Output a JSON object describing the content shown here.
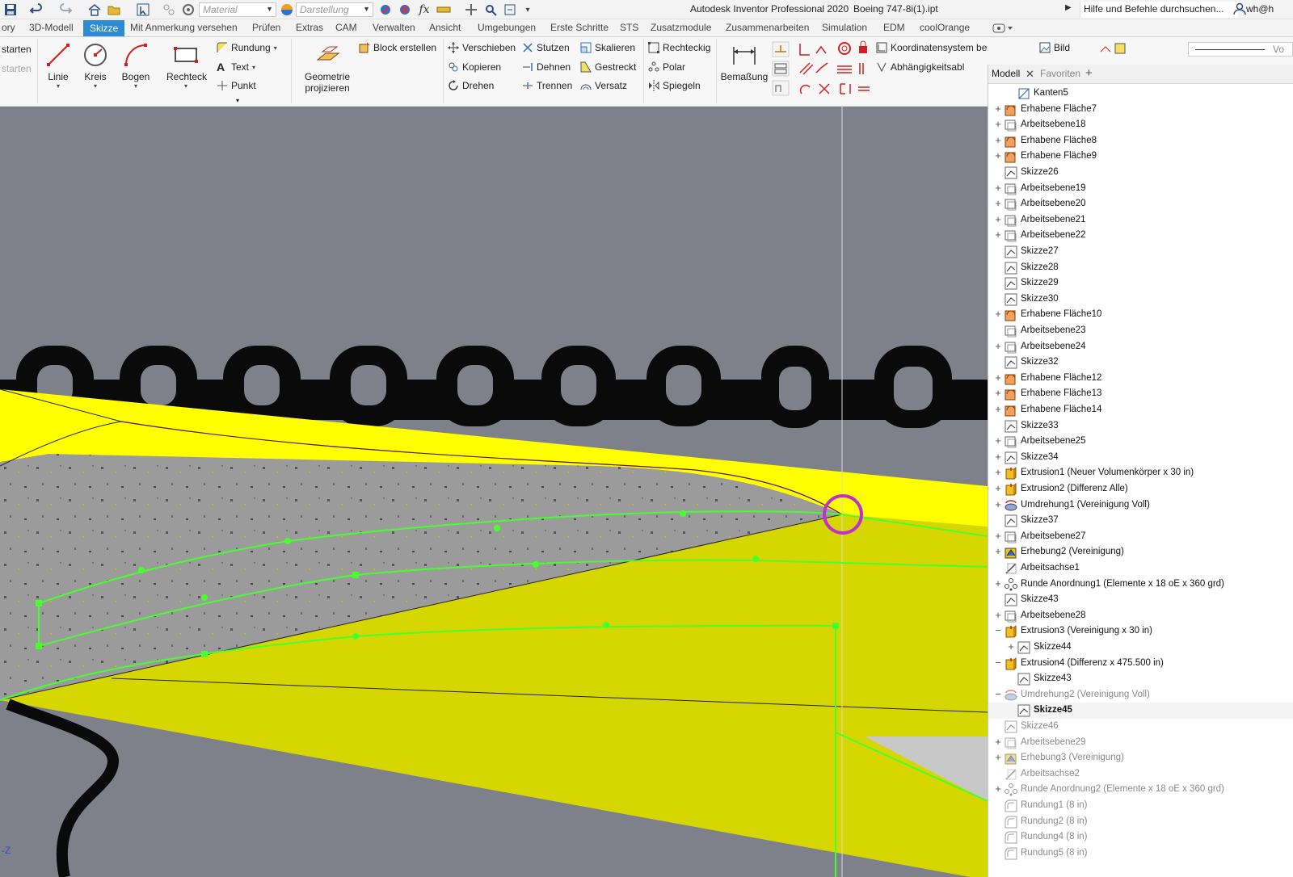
{
  "titlebar": {
    "material_placeholder": "Material",
    "appearance_placeholder": "Darstellung",
    "app_title": "Autodesk Inventor Professional 2020",
    "doc_title": "Boeing 747-8i(1).ipt",
    "help_search": "Hilfe und Befehle durchsuchen...",
    "user": "wh@h"
  },
  "tabs": [
    {
      "label": "ory",
      "active": false
    },
    {
      "label": "3D-Modell",
      "active": false
    },
    {
      "label": "Skizze",
      "active": true
    },
    {
      "label": "Mit Anmerkung versehen",
      "active": false
    },
    {
      "label": "Prüfen",
      "active": false
    },
    {
      "label": "Extras",
      "active": false
    },
    {
      "label": "CAM",
      "active": false
    },
    {
      "label": "Verwalten",
      "active": false
    },
    {
      "label": "Ansicht",
      "active": false
    },
    {
      "label": "Umgebungen",
      "active": false
    },
    {
      "label": "Erste Schritte",
      "active": false
    },
    {
      "label": "STS",
      "active": false
    },
    {
      "label": "Zusatzmodule",
      "active": false
    },
    {
      "label": "Zusammenarbeiten",
      "active": false
    },
    {
      "label": "Simulation",
      "active": false
    },
    {
      "label": "EDM",
      "active": false
    },
    {
      "label": "coolOrange",
      "active": false
    }
  ],
  "ribbon": {
    "start1": "starten",
    "start2": "starten",
    "linie": "Linie",
    "kreis": "Kreis",
    "bogen": "Bogen",
    "rechteck": "Rechteck",
    "rundung": "Rundung",
    "text": "Text",
    "punkt": "Punkt",
    "geometrie1": "Geometrie",
    "geometrie2": "projizieren",
    "block": "Block erstellen",
    "verschieben": "Verschieben",
    "kopieren": "Kopieren",
    "drehen": "Drehen",
    "stutzen": "Stutzen",
    "dehnen": "Dehnen",
    "trennen": "Trennen",
    "skalieren": "Skalieren",
    "gestreckt": "Gestreckt",
    "versatz": "Versatz",
    "rechteckig": "Rechteckig",
    "polar": "Polar",
    "spiegeln": "Spiegeln",
    "bemassung": "Bemaßung",
    "koordinaten": "Koordinatensystem bearbeiten",
    "abhaengigkeit": "Abhängigkeitsabl",
    "bild": "Bild",
    "vor": "Vo"
  },
  "viewport": {
    "axis_label": "-Z"
  },
  "browser": {
    "tab_model": "Modell",
    "tab_favorites": "Favoriten",
    "nodes": [
      {
        "label": "Kanten5",
        "icon": "edges",
        "expander": "",
        "indent": 1,
        "state": "normal"
      },
      {
        "label": "Erhabene Fläche7",
        "icon": "surface",
        "expander": "+",
        "indent": 0,
        "state": "normal"
      },
      {
        "label": "Arbeitsebene18",
        "icon": "plane",
        "expander": "+",
        "indent": 0,
        "state": "normal"
      },
      {
        "label": "Erhabene Fläche8",
        "icon": "surface",
        "expander": "+",
        "indent": 0,
        "state": "normal"
      },
      {
        "label": "Erhabene Fläche9",
        "icon": "surface",
        "expander": "+",
        "indent": 0,
        "state": "normal"
      },
      {
        "label": "Skizze26",
        "icon": "sketch",
        "expander": "",
        "indent": 0,
        "state": "normal"
      },
      {
        "label": "Arbeitsebene19",
        "icon": "plane",
        "expander": "+",
        "indent": 0,
        "state": "normal"
      },
      {
        "label": "Arbeitsebene20",
        "icon": "plane",
        "expander": "+",
        "indent": 0,
        "state": "normal"
      },
      {
        "label": "Arbeitsebene21",
        "icon": "plane",
        "expander": "+",
        "indent": 0,
        "state": "normal"
      },
      {
        "label": "Arbeitsebene22",
        "icon": "plane",
        "expander": "+",
        "indent": 0,
        "state": "normal"
      },
      {
        "label": "Skizze27",
        "icon": "sketch",
        "expander": "",
        "indent": 0,
        "state": "normal"
      },
      {
        "label": "Skizze28",
        "icon": "sketch",
        "expander": "",
        "indent": 0,
        "state": "normal"
      },
      {
        "label": "Skizze29",
        "icon": "sketch",
        "expander": "",
        "indent": 0,
        "state": "normal"
      },
      {
        "label": "Skizze30",
        "icon": "sketch",
        "expander": "",
        "indent": 0,
        "state": "normal"
      },
      {
        "label": "Erhabene Fläche10",
        "icon": "surface",
        "expander": "+",
        "indent": 0,
        "state": "normal"
      },
      {
        "label": "Arbeitsebene23",
        "icon": "plane",
        "expander": "",
        "indent": 0,
        "state": "normal"
      },
      {
        "label": "Arbeitsebene24",
        "icon": "plane",
        "expander": "+",
        "indent": 0,
        "state": "normal"
      },
      {
        "label": "Skizze32",
        "icon": "sketch",
        "expander": "",
        "indent": 0,
        "state": "normal"
      },
      {
        "label": "Erhabene Fläche12",
        "icon": "surface",
        "expander": "+",
        "indent": 0,
        "state": "normal"
      },
      {
        "label": "Erhabene Fläche13",
        "icon": "surface",
        "expander": "+",
        "indent": 0,
        "state": "normal"
      },
      {
        "label": "Erhabene Fläche14",
        "icon": "surface",
        "expander": "+",
        "indent": 0,
        "state": "normal"
      },
      {
        "label": "Skizze33",
        "icon": "sketch",
        "expander": "",
        "indent": 0,
        "state": "normal"
      },
      {
        "label": "Arbeitsebene25",
        "icon": "plane",
        "expander": "+",
        "indent": 0,
        "state": "normal"
      },
      {
        "label": "Skizze34",
        "icon": "sketch",
        "expander": "+",
        "indent": 0,
        "state": "normal"
      },
      {
        "label": "Extrusion1 (Neuer Volumenkörper x 30 in)",
        "icon": "extrude",
        "expander": "+",
        "indent": 0,
        "state": "normal"
      },
      {
        "label": "Extrusion2 (Differenz Alle)",
        "icon": "extrude",
        "expander": "+",
        "indent": 0,
        "state": "normal"
      },
      {
        "label": "Umdrehung1 (Vereinigung Voll)",
        "icon": "revolve",
        "expander": "+",
        "indent": 0,
        "state": "normal"
      },
      {
        "label": "Skizze37",
        "icon": "sketch",
        "expander": "",
        "indent": 0,
        "state": "normal"
      },
      {
        "label": "Arbeitsebene27",
        "icon": "plane",
        "expander": "+",
        "indent": 0,
        "state": "normal"
      },
      {
        "label": "Erhebung2 (Vereinigung)",
        "icon": "loft",
        "expander": "+",
        "indent": 0,
        "state": "normal"
      },
      {
        "label": "Arbeitsachse1",
        "icon": "axis",
        "expander": "",
        "indent": 0,
        "state": "normal"
      },
      {
        "label": "Runde Anordnung1 (Elemente x 18 oE x 360 grd)",
        "icon": "pattern",
        "expander": "+",
        "indent": 0,
        "state": "normal"
      },
      {
        "label": "Skizze43",
        "icon": "sketch",
        "expander": "",
        "indent": 0,
        "state": "normal"
      },
      {
        "label": "Arbeitsebene28",
        "icon": "plane",
        "expander": "+",
        "indent": 0,
        "state": "normal"
      },
      {
        "label": "Extrusion3 (Vereinigung x 30 in)",
        "icon": "extrude",
        "expander": "−",
        "indent": 0,
        "state": "normal"
      },
      {
        "label": "Skizze44",
        "icon": "sketch",
        "expander": "+",
        "indent": 1,
        "state": "normal"
      },
      {
        "label": "Extrusion4 (Differenz x 475.500 in)",
        "icon": "extrude",
        "expander": "−",
        "indent": 0,
        "state": "normal"
      },
      {
        "label": "Skizze43",
        "icon": "sketch",
        "expander": "",
        "indent": 1,
        "state": "normal"
      },
      {
        "label": "Umdrehung2 (Vereinigung Voll)",
        "icon": "revolve",
        "expander": "−",
        "indent": 0,
        "state": "dim"
      },
      {
        "label": "Skizze45",
        "icon": "sketch",
        "expander": "",
        "indent": 1,
        "state": "bold"
      },
      {
        "label": "Skizze46",
        "icon": "sketch",
        "expander": "",
        "indent": 0,
        "state": "dim"
      },
      {
        "label": "Arbeitsebene29",
        "icon": "plane",
        "expander": "+",
        "indent": 0,
        "state": "dim"
      },
      {
        "label": "Erhebung3 (Vereinigung)",
        "icon": "loft",
        "expander": "+",
        "indent": 0,
        "state": "dim"
      },
      {
        "label": "Arbeitsachse2",
        "icon": "axis",
        "expander": "",
        "indent": 0,
        "state": "dim"
      },
      {
        "label": "Runde Anordnung2 (Elemente x 18 oE x 360 grd)",
        "icon": "pattern",
        "expander": "+",
        "indent": 0,
        "state": "dim"
      },
      {
        "label": "Rundung1 (8 in)",
        "icon": "fillet",
        "expander": "",
        "indent": 0,
        "state": "dim"
      },
      {
        "label": "Rundung2 (8 in)",
        "icon": "fillet",
        "expander": "",
        "indent": 0,
        "state": "dim"
      },
      {
        "label": "Rundung4 (8 in)",
        "icon": "fillet",
        "expander": "",
        "indent": 0,
        "state": "dim"
      },
      {
        "label": "Rundung5 (8 in)",
        "icon": "fillet",
        "expander": "",
        "indent": 0,
        "state": "dim"
      }
    ]
  },
  "colors": {
    "accent": "#2d8bd6",
    "viewport_bg": "#7e818a",
    "surface_yellow": "#d6d600",
    "surface_bright": "#ffff00",
    "sketch_green": "#47ff2e",
    "highlight_magenta": "#c030d0"
  }
}
